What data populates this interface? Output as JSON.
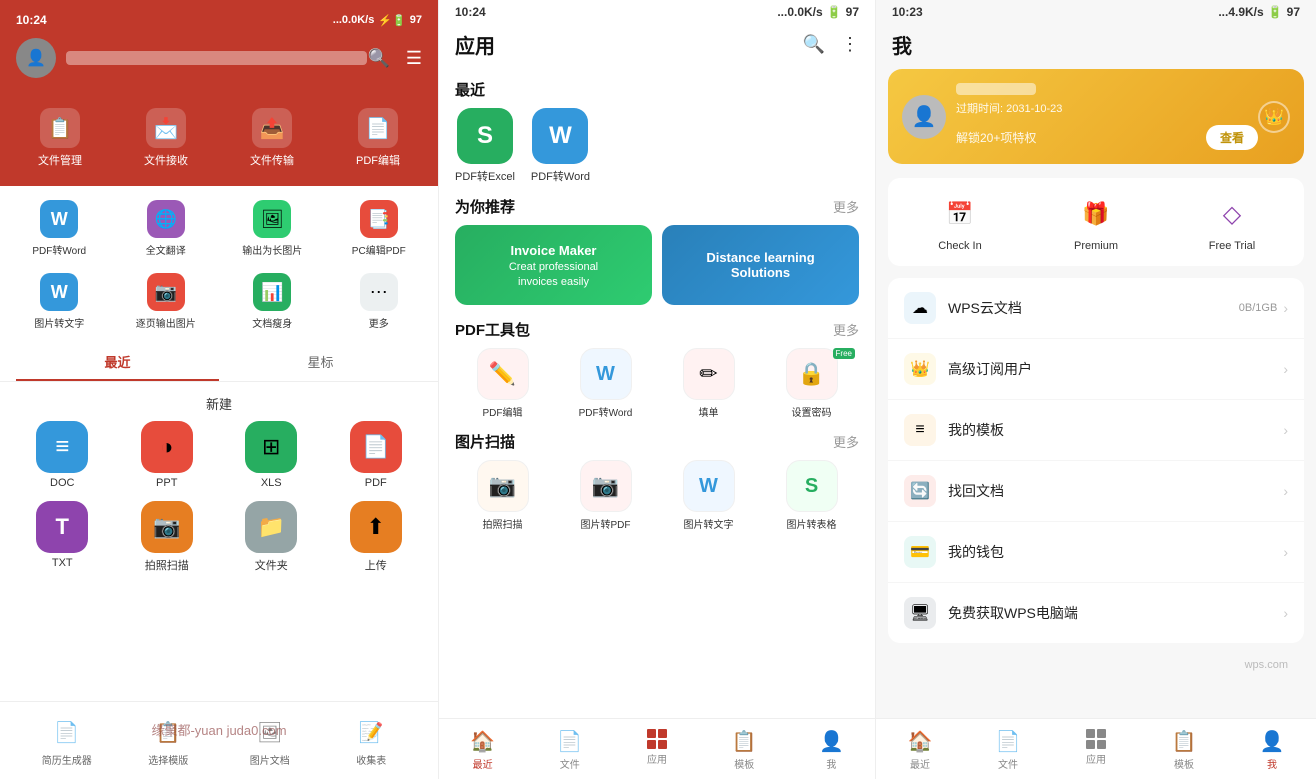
{
  "panel1": {
    "statusbar": {
      "time": "10:24",
      "signal": "...0.0K/s",
      "battery": "97"
    },
    "header_icons": [
      "search",
      "menu"
    ],
    "top_grid": [
      {
        "label": "文件管理",
        "bg": "#e74c3c",
        "icon": "📋"
      },
      {
        "label": "文件接收",
        "bg": "#e74c3c",
        "icon": "📩"
      },
      {
        "label": "文件传输",
        "bg": "#e74c3c",
        "icon": "📤"
      },
      {
        "label": "PDF编辑",
        "bg": "#e74c3c",
        "icon": "📄"
      }
    ],
    "sub_grid": [
      {
        "label": "PDF转Word",
        "bg": "#3498db",
        "icon": "W"
      },
      {
        "label": "全文翻译",
        "bg": "#9b59b6",
        "icon": "🌐"
      },
      {
        "label": "输出为长图片",
        "bg": "#2ecc71",
        "icon": "🖼"
      },
      {
        "label": "PC编辑PDF",
        "bg": "#e74c3c",
        "icon": "📑"
      },
      {
        "label": "图片转文字",
        "bg": "#3498db",
        "icon": "W"
      },
      {
        "label": "逐页输出图片",
        "bg": "#e74c3c",
        "icon": "📷"
      },
      {
        "label": "文档瘦身",
        "bg": "#27ae60",
        "icon": "📊"
      },
      {
        "label": "更多",
        "bg": "#95a5a6",
        "icon": "⋯"
      }
    ],
    "tabs": [
      {
        "label": "最近",
        "active": true
      },
      {
        "label": "星标",
        "active": false
      }
    ],
    "new_section_title": "新建",
    "new_grid1": [
      {
        "label": "DOC",
        "bg": "#3498db",
        "icon": "≡"
      },
      {
        "label": "PPT",
        "bg": "#e74c3c",
        "icon": "◑"
      },
      {
        "label": "XLS",
        "bg": "#27ae60",
        "icon": "⊞"
      },
      {
        "label": "PDF",
        "bg": "#e74c3c",
        "icon": "📄"
      }
    ],
    "new_grid2": [
      {
        "label": "TXT",
        "bg": "#8e44ad",
        "icon": "T"
      },
      {
        "label": "拍照扫描",
        "bg": "#e67e22",
        "icon": "📷"
      },
      {
        "label": "文件夹",
        "bg": "#7f8c8d",
        "icon": "📁"
      },
      {
        "label": "上传",
        "bg": "#e67e22",
        "icon": "⬆"
      }
    ],
    "bottom_tools": [
      {
        "label": "简历生成器",
        "icon": "📄"
      },
      {
        "label": "选择模版",
        "icon": "📋"
      },
      {
        "label": "图片文档",
        "icon": "🖼"
      },
      {
        "label": "收集表",
        "icon": "📝"
      }
    ]
  },
  "panel2": {
    "statusbar": {
      "time": "10:24",
      "signal": "...0.0K/s",
      "battery": "97"
    },
    "title": "应用",
    "recent_title": "最近",
    "recent_items": [
      {
        "label": "PDF转Excel",
        "icon": "S",
        "bg": "#27ae60"
      },
      {
        "label": "PDF转Word",
        "icon": "W",
        "bg": "#3498db"
      }
    ],
    "recommend_title": "为你推荐",
    "more": "更多",
    "promos": [
      {
        "text": "Invoice Maker\nCreat professional\ninvoices easily",
        "bg": "green"
      },
      {
        "text": "Distance learning\nSolutions",
        "bg": "blue"
      }
    ],
    "pdf_tools_title": "PDF工具包",
    "pdf_tools": [
      {
        "label": "PDF编辑",
        "bg": "#e74c3c",
        "icon": "✏️"
      },
      {
        "label": "PDF转Word",
        "bg": "#3498db",
        "icon": "W"
      },
      {
        "label": "填单",
        "bg": "#e74c3c",
        "icon": "✏"
      },
      {
        "label": "设置密码",
        "bg": "#e74c3c",
        "icon": "🔒",
        "free": true
      }
    ],
    "image_tools_title": "图片扫描",
    "image_tools": [
      {
        "label": "拍照扫描",
        "bg": "#e67e22",
        "icon": "📷"
      },
      {
        "label": "图片转PDF",
        "bg": "#e74c3c",
        "icon": "📷"
      },
      {
        "label": "图片转文字",
        "bg": "#3498db",
        "icon": "W"
      },
      {
        "label": "图片转表格",
        "bg": "#27ae60",
        "icon": "S"
      }
    ],
    "nav": [
      {
        "label": "最近",
        "icon": "🏠",
        "active": true
      },
      {
        "label": "文件",
        "icon": "📄",
        "active": false
      },
      {
        "label": "应用",
        "icon": "grid",
        "active": false
      },
      {
        "label": "模板",
        "icon": "📋",
        "active": false
      },
      {
        "label": "我",
        "icon": "👤",
        "active": false
      }
    ]
  },
  "panel3": {
    "statusbar": {
      "time": "10:23",
      "signal": "...4.9K/s",
      "battery": "97"
    },
    "title": "我",
    "vip_expire": "过期时间: 2031-10-23",
    "vip_unlock": "解锁20+项特权",
    "vip_check_label": "查看",
    "quick_actions": [
      {
        "label": "Check In",
        "icon": "📅"
      },
      {
        "label": "Premium",
        "icon": "🎁"
      },
      {
        "label": "Free Trial",
        "icon": "◇"
      }
    ],
    "menu_items": [
      {
        "label": "WPS云文档",
        "icon": "☁",
        "icon_bg": "#3498db",
        "right": "0B/1GB"
      },
      {
        "label": "高级订阅用户",
        "icon": "👑",
        "icon_bg": "#f39c12",
        "right": ""
      },
      {
        "label": "我的模板",
        "icon": "≡",
        "icon_bg": "#e67e22",
        "right": ""
      },
      {
        "label": "找回文档",
        "icon": "🔄",
        "icon_bg": "#e74c3c",
        "right": ""
      },
      {
        "label": "我的钱包",
        "icon": "💳",
        "icon_bg": "#1abc9c",
        "right": ""
      },
      {
        "label": "免费获取WPS电脑端",
        "icon": "🖥",
        "icon_bg": "#2c3e50",
        "right": ""
      }
    ],
    "wps_footer": "wps.com",
    "nav": [
      {
        "label": "最近",
        "icon": "🏠",
        "active": false
      },
      {
        "label": "文件",
        "icon": "📄",
        "active": false
      },
      {
        "label": "应用",
        "icon": "grid",
        "active": false
      },
      {
        "label": "模板",
        "icon": "📋",
        "active": false
      },
      {
        "label": "我",
        "icon": "👤",
        "active": true
      }
    ]
  },
  "watermark": "缘聚都-yuan juda0.com"
}
